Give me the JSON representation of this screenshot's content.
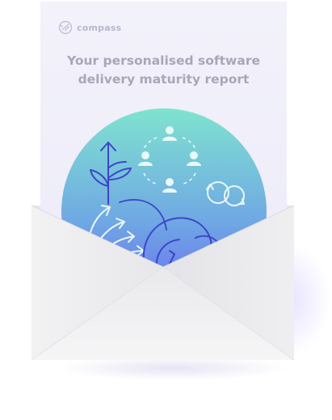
{
  "brand": {
    "name": "compass",
    "icon": "compass-logo-icon"
  },
  "report": {
    "title_line1": "Your personalised software",
    "title_line2": "delivery maturity report"
  },
  "illustration": {
    "icons": [
      "plant-arrow-icon",
      "team-cycle-icon",
      "growth-arrows-icon",
      "head-profile-icon",
      "cycle-arrows-icon"
    ]
  },
  "colors": {
    "hero_top": "#7ee0cf",
    "hero_bottom": "#6b6ff2",
    "line": "#3b3fc9",
    "envelope": "#f1f1f1"
  }
}
